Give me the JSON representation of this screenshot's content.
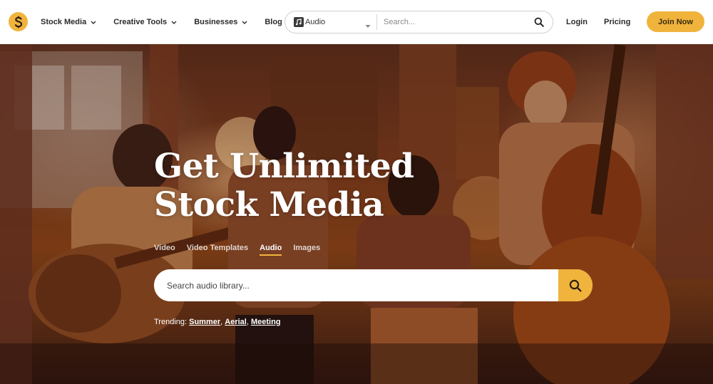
{
  "nav": {
    "logo_icon": "dollar-s-icon",
    "menu": [
      {
        "label": "Stock Media",
        "has_dropdown": true
      },
      {
        "label": "Creative Tools",
        "has_dropdown": true
      },
      {
        "label": "Businesses",
        "has_dropdown": true
      },
      {
        "label": "Blog",
        "has_dropdown": false
      }
    ],
    "search": {
      "type_value": "Audio",
      "placeholder": "Search..."
    },
    "login_label": "Login",
    "pricing_label": "Pricing",
    "join_label": "Join Now"
  },
  "hero": {
    "headline_line1": "Get Unlimited",
    "headline_line2": "Stock Media",
    "tabs": [
      {
        "label": "Video",
        "active": false
      },
      {
        "label": "Video Templates",
        "active": false
      },
      {
        "label": "Audio",
        "active": true
      },
      {
        "label": "Images",
        "active": false
      }
    ],
    "search_placeholder": "Search audio library...",
    "trending_label": "Trending:",
    "trending_links": [
      "Summer",
      "Aerial",
      "Meeting"
    ],
    "trending_separator": ","
  },
  "colors": {
    "accent": "#f0b43c",
    "nav_text": "#2b2b2b",
    "hero_text": "#ffffff"
  }
}
